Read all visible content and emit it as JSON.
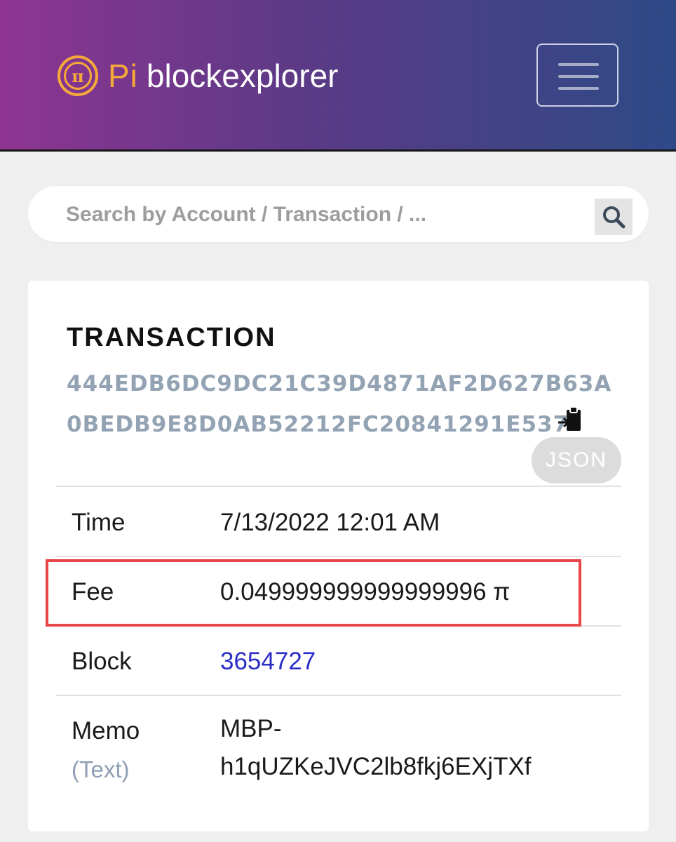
{
  "header": {
    "logo_pi": "Pi",
    "logo_text": "blockexplorer",
    "logo_mark_glyph": "π",
    "menu_icon": "hamburger-icon"
  },
  "search": {
    "placeholder": "Search by Account / Transaction / ...",
    "button_icon": "search-icon"
  },
  "transaction": {
    "title": "TRANSACTION",
    "hash_line1": "444EDB6DC9DC21C39D4871AF2D627B63A",
    "hash_line2": "0BEDB9E8D0AB52212FC20841291E537",
    "copy_icon": "clipboard-copy-icon",
    "json_label": "JSON",
    "rows": [
      {
        "label": "Time",
        "value": "7/13/2022 12:01 AM"
      },
      {
        "label": "Fee",
        "value": "0.049999999999999996 π"
      },
      {
        "label": "Block",
        "value": "3654727"
      },
      {
        "label": "Memo",
        "sublabel": "(Text)",
        "value_line1": "MBP-",
        "value_line2": "h1qUZKeJVC2lb8fkj6EXjTXf"
      }
    ]
  },
  "colors": {
    "header_gradient_start": "#8e3591",
    "header_gradient_end": "#2e4a86",
    "pi_orange": "#f6a93a",
    "hash_color": "#93a3b4",
    "link_color": "#2a2ec7",
    "highlight_red": "#e8454a"
  }
}
